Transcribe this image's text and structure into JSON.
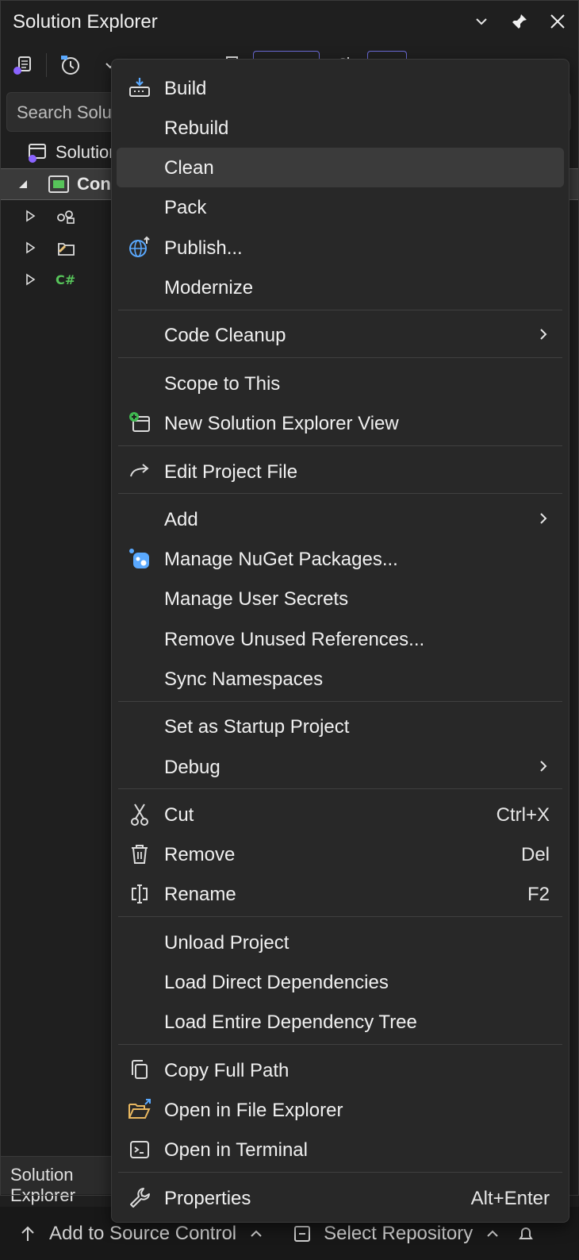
{
  "panel": {
    "title": "Solution Explorer",
    "search_placeholder": "Search Solution Explorer (Ctrl+;)",
    "tree": {
      "solution_label": "Solution 'ConsoleApp1' (1 of 1 project)",
      "project_label": "ConsoleApp1"
    },
    "bottom_tab": "Solution Explorer"
  },
  "statusbar": {
    "source_control": "Add to Source Control",
    "repository": "Select Repository"
  },
  "menu": {
    "items": [
      {
        "id": "build",
        "label": "Build",
        "icon": "build-icon"
      },
      {
        "id": "rebuild",
        "label": "Rebuild"
      },
      {
        "id": "clean",
        "label": "Clean",
        "hover": true
      },
      {
        "id": "pack",
        "label": "Pack"
      },
      {
        "id": "publish",
        "label": "Publish...",
        "icon": "globe-icon"
      },
      {
        "id": "modernize",
        "label": "Modernize"
      },
      {
        "id": "code-cleanup",
        "label": "Code Cleanup",
        "submenu": true
      },
      {
        "id": "scope-to-this",
        "label": "Scope to This"
      },
      {
        "id": "new-solution-explorer-view",
        "label": "New Solution Explorer View",
        "icon": "new-view-icon"
      },
      {
        "id": "edit-project-file",
        "label": "Edit Project File",
        "icon": "arrow-right-icon"
      },
      {
        "id": "add",
        "label": "Add",
        "submenu": true
      },
      {
        "id": "manage-nuget-packages",
        "label": "Manage NuGet Packages...",
        "icon": "nuget-icon"
      },
      {
        "id": "manage-user-secrets",
        "label": "Manage User Secrets"
      },
      {
        "id": "remove-unused-references",
        "label": "Remove Unused References..."
      },
      {
        "id": "sync-namespaces",
        "label": "Sync Namespaces"
      },
      {
        "id": "set-as-startup-project",
        "label": "Set as Startup Project"
      },
      {
        "id": "debug",
        "label": "Debug",
        "submenu": true
      },
      {
        "id": "cut",
        "label": "Cut",
        "icon": "scissors-icon",
        "shortcut": "Ctrl+X"
      },
      {
        "id": "remove",
        "label": "Remove",
        "icon": "trash-icon",
        "shortcut": "Del"
      },
      {
        "id": "rename",
        "label": "Rename",
        "icon": "rename-icon",
        "shortcut": "F2"
      },
      {
        "id": "unload-project",
        "label": "Unload Project"
      },
      {
        "id": "load-direct-dependencies",
        "label": "Load Direct Dependencies"
      },
      {
        "id": "load-entire-dependency-tree",
        "label": "Load Entire Dependency Tree"
      },
      {
        "id": "copy-full-path",
        "label": "Copy Full Path",
        "icon": "copy-icon"
      },
      {
        "id": "open-in-file-explorer",
        "label": "Open in File Explorer",
        "icon": "folder-icon"
      },
      {
        "id": "open-in-terminal",
        "label": "Open in Terminal",
        "icon": "terminal-icon"
      },
      {
        "id": "properties",
        "label": "Properties",
        "icon": "wrench-icon",
        "shortcut": "Alt+Enter"
      }
    ]
  },
  "colors": {
    "background": "#1f1f1f",
    "menu_background": "#282828",
    "hover": "#3b3b3b",
    "accent_purple": "#8a63ff",
    "nuget_blue": "#5aa9ff",
    "csharp_green": "#57c45a"
  }
}
